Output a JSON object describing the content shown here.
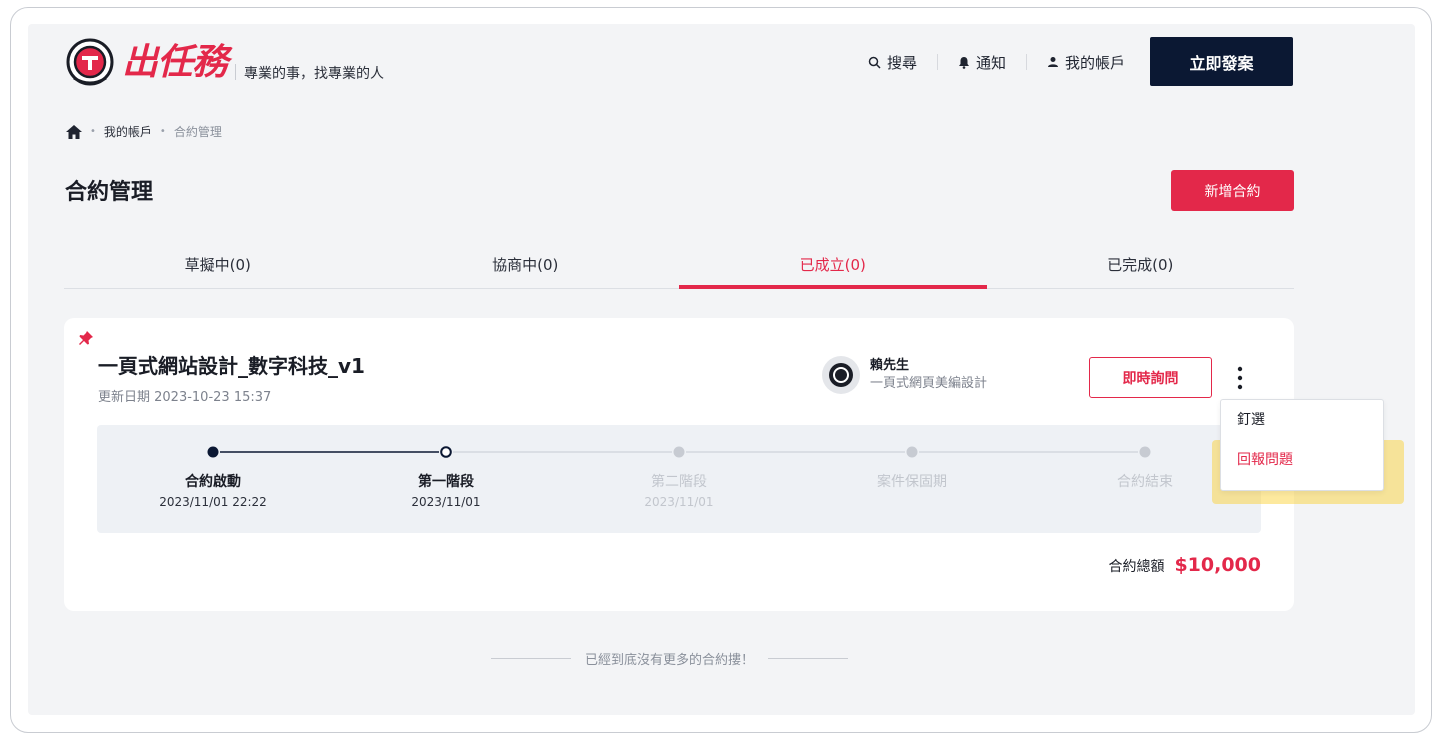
{
  "header": {
    "logo_text": "出任務",
    "tagline": "專業的事，找專業的人",
    "nav": [
      {
        "label": "搜尋",
        "icon": "search-icon"
      },
      {
        "label": "通知",
        "icon": "bell-icon"
      },
      {
        "label": "我的帳戶",
        "icon": "user-icon"
      }
    ],
    "cta_label": "立即發案"
  },
  "breadcrumb": {
    "home_icon": "home-icon",
    "items": [
      "我的帳戶",
      "合約管理"
    ]
  },
  "page": {
    "title": "合約管理",
    "add_button_label": "新增合約"
  },
  "tabs": [
    {
      "label": "草擬中(0)",
      "active": false
    },
    {
      "label": "協商中(0)",
      "active": false
    },
    {
      "label": "已成立(0)",
      "active": true
    },
    {
      "label": "已完成(0)",
      "active": false
    }
  ],
  "contract": {
    "pinned": true,
    "title": "一頁式網站設計_數字科技_v1",
    "updated": "更新日期 2023-10-23 15:37",
    "person": {
      "name": "賴先生",
      "role": "一頁式網頁美編設計"
    },
    "chat_button_label": "即時詢問",
    "steps": [
      {
        "label": "合約啟動",
        "date": "2023/11/01 22:22",
        "status": "done"
      },
      {
        "label": "第一階段",
        "date": "2023/11/01",
        "status": "current"
      },
      {
        "label": "第二階段",
        "date": "2023/11/01",
        "status": "pending"
      },
      {
        "label": "案件保固期",
        "date": "",
        "status": "pending"
      },
      {
        "label": "合約結束",
        "date": "",
        "status": "pending"
      }
    ],
    "total_label": "合約總額",
    "total_value": "$10,000"
  },
  "dropdown": {
    "items": [
      "釘選",
      "回報問題"
    ],
    "highlighted": "回報問題"
  },
  "footer_note": "已經到底沒有更多的合約摟！",
  "colors": {
    "brand_red": "#e3284a",
    "navy": "#0b1833",
    "highlight": "#face28"
  }
}
